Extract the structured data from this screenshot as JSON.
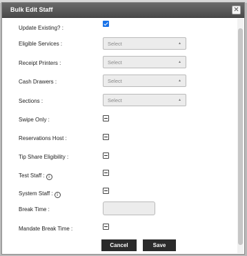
{
  "dialog": {
    "title": "Bulk Edit Staff",
    "close_symbol": "✕"
  },
  "fields": {
    "update_existing": {
      "label": "Update Existing? :",
      "state": "checked"
    },
    "eligible_services": {
      "label": "Eligible Services :",
      "value": "Select"
    },
    "receipt_printers": {
      "label": "Receipt Printers :",
      "value": "Select"
    },
    "cash_drawers": {
      "label": "Cash Drawers :",
      "value": "Select"
    },
    "sections": {
      "label": "Sections :",
      "value": "Select"
    },
    "swipe_only": {
      "label": "Swipe Only :",
      "state": "indeterminate"
    },
    "reservations_host": {
      "label": "Reservations Host :",
      "state": "indeterminate"
    },
    "tip_share_eligibility": {
      "label": "Tip Share Eligibility :",
      "state": "indeterminate"
    },
    "test_staff": {
      "label": "Test Staff :",
      "state": "indeterminate"
    },
    "system_staff": {
      "label": "System Staff :",
      "state": "indeterminate"
    },
    "break_time": {
      "label": "Break Time :",
      "value": ""
    },
    "mandate_break_time": {
      "label": "Mandate Break Time :",
      "state": "indeterminate"
    }
  },
  "select_arrow_symbol": "▲",
  "info_symbol": "i",
  "buttons": {
    "cancel": "Cancel",
    "save": "Save"
  },
  "colors": {
    "header_bg": "#555555",
    "checkbox_checked": "#1a73e8",
    "button_bg": "#2b2b2b"
  }
}
